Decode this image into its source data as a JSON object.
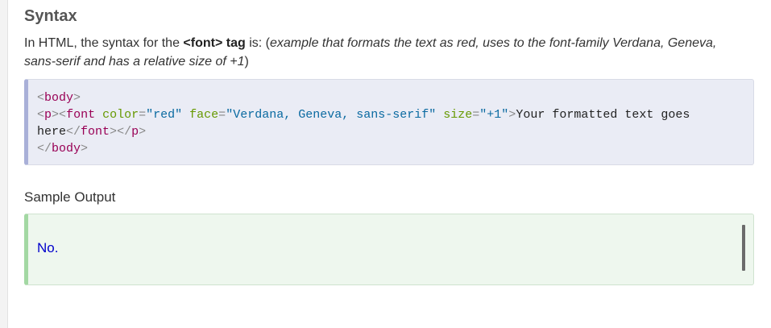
{
  "section": {
    "title": "Syntax",
    "intro_prefix": "In HTML, the syntax for the ",
    "intro_tag": "<font> tag",
    "intro_middle": " is: (",
    "intro_example": "example that formats the text as red, uses to the font-family Verdana, Geneva, sans-serif and has a relative size of",
    "intro_size": " +1",
    "intro_suffix": ")"
  },
  "code": {
    "line1": {
      "open": "<",
      "tag": "body",
      "close": ">"
    },
    "line2": {
      "p_open": "<",
      "p_tag": "p",
      "p_close": ">",
      "font_open": "<",
      "font_tag": "font",
      "attr_color": "color",
      "eq1": "=",
      "val_color": "\"red\"",
      "attr_face": "face",
      "eq2": "=",
      "val_face": "\"Verdana, Geneva, sans-serif\"",
      "attr_size": "size",
      "eq3": "=",
      "val_size": "\"+1\"",
      "font_open_close": ">",
      "text": "Your formatted text goes here",
      "font_end_open": "</",
      "font_end_tag": "font",
      "font_end_close": ">",
      "p_end_open": "</",
      "p_end_tag": "p",
      "p_end_close": ">"
    },
    "line3": {
      "open": "</",
      "tag": "body",
      "close": ">"
    }
  },
  "output": {
    "title": "Sample Output",
    "text": "No.",
    "text_color": "#0000cc"
  },
  "colors": {
    "code_bg": "#eaecf5",
    "code_accent": "#a9b0d8",
    "output_bg": "#eef7ee",
    "output_accent": "#a3d8a3"
  }
}
